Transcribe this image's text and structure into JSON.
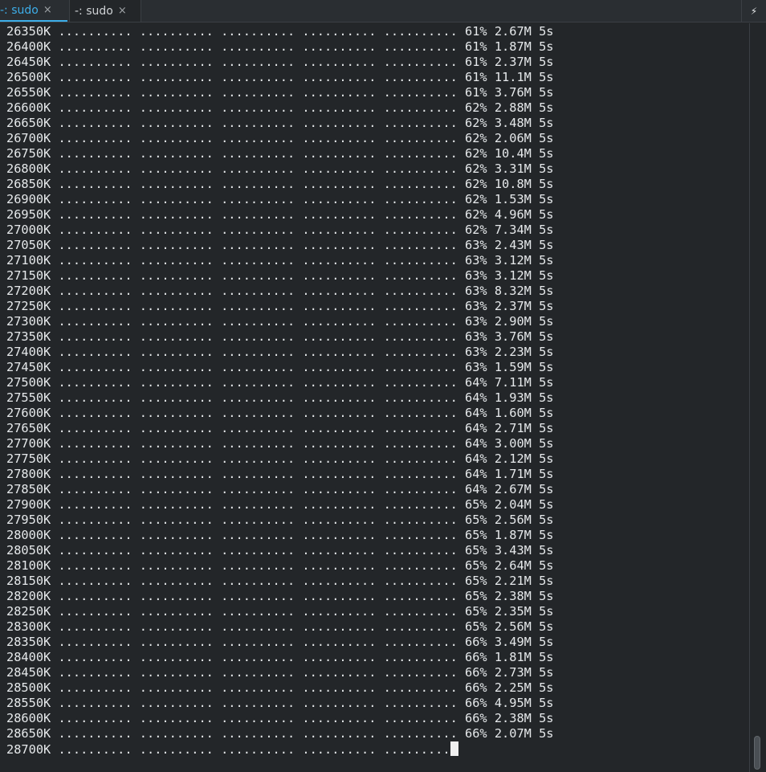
{
  "tabs": [
    {
      "label": "-: sudo",
      "active": false
    },
    {
      "label": "-: sudo",
      "active": true
    }
  ],
  "tab_close_glyph": "×",
  "tabbar_menu_glyph": "⚡",
  "terminal": {
    "lines": [
      "26350K .......... .......... .......... .......... .......... 61% 2.67M 5s",
      "26400K .......... .......... .......... .......... .......... 61% 1.87M 5s",
      "26450K .......... .......... .......... .......... .......... 61% 2.37M 5s",
      "26500K .......... .......... .......... .......... .......... 61% 11.1M 5s",
      "26550K .......... .......... .......... .......... .......... 61% 3.76M 5s",
      "26600K .......... .......... .......... .......... .......... 62% 2.88M 5s",
      "26650K .......... .......... .......... .......... .......... 62% 3.48M 5s",
      "26700K .......... .......... .......... .......... .......... 62% 2.06M 5s",
      "26750K .......... .......... .......... .......... .......... 62% 10.4M 5s",
      "26800K .......... .......... .......... .......... .......... 62% 3.31M 5s",
      "26850K .......... .......... .......... .......... .......... 62% 10.8M 5s",
      "26900K .......... .......... .......... .......... .......... 62% 1.53M 5s",
      "26950K .......... .......... .......... .......... .......... 62% 4.96M 5s",
      "27000K .......... .......... .......... .......... .......... 62% 7.34M 5s",
      "27050K .......... .......... .......... .......... .......... 63% 2.43M 5s",
      "27100K .......... .......... .......... .......... .......... 63% 3.12M 5s",
      "27150K .......... .......... .......... .......... .......... 63% 3.12M 5s",
      "27200K .......... .......... .......... .......... .......... 63% 8.32M 5s",
      "27250K .......... .......... .......... .......... .......... 63% 2.37M 5s",
      "27300K .......... .......... .......... .......... .......... 63% 2.90M 5s",
      "27350K .......... .......... .......... .......... .......... 63% 3.76M 5s",
      "27400K .......... .......... .......... .......... .......... 63% 2.23M 5s",
      "27450K .......... .......... .......... .......... .......... 63% 1.59M 5s",
      "27500K .......... .......... .......... .......... .......... 64% 7.11M 5s",
      "27550K .......... .......... .......... .......... .......... 64% 1.93M 5s",
      "27600K .......... .......... .......... .......... .......... 64% 1.60M 5s",
      "27650K .......... .......... .......... .......... .......... 64% 2.71M 5s",
      "27700K .......... .......... .......... .......... .......... 64% 3.00M 5s",
      "27750K .......... .......... .......... .......... .......... 64% 2.12M 5s",
      "27800K .......... .......... .......... .......... .......... 64% 1.71M 5s",
      "27850K .......... .......... .......... .......... .......... 64% 2.67M 5s",
      "27900K .......... .......... .......... .......... .......... 65% 2.04M 5s",
      "27950K .......... .......... .......... .......... .......... 65% 2.56M 5s",
      "28000K .......... .......... .......... .......... .......... 65% 1.87M 5s",
      "28050K .......... .......... .......... .......... .......... 65% 3.43M 5s",
      "28100K .......... .......... .......... .......... .......... 65% 2.64M 5s",
      "28150K .......... .......... .......... .......... .......... 65% 2.21M 5s",
      "28200K .......... .......... .......... .......... .......... 65% 2.38M 5s",
      "28250K .......... .......... .......... .......... .......... 65% 2.35M 5s",
      "28300K .......... .......... .......... .......... .......... 65% 2.56M 5s",
      "28350K .......... .......... .......... .......... .......... 66% 3.49M 5s",
      "28400K .......... .......... .......... .......... .......... 66% 1.81M 5s",
      "28450K .......... .......... .......... .......... .......... 66% 2.73M 5s",
      "28500K .......... .......... .......... .......... .......... 66% 2.25M 5s",
      "28550K .......... .......... .......... .......... .......... 66% 4.95M 5s",
      "28600K .......... .......... .......... .......... .......... 66% 2.38M 5s",
      "28650K .......... .......... .......... .......... .......... 66% 2.07M 5s"
    ],
    "current_line": "28700K .......... .......... .......... .......... ........."
  },
  "colors": {
    "background": "#232629",
    "foreground": "#e6e9eb",
    "accent": "#3daee9"
  }
}
